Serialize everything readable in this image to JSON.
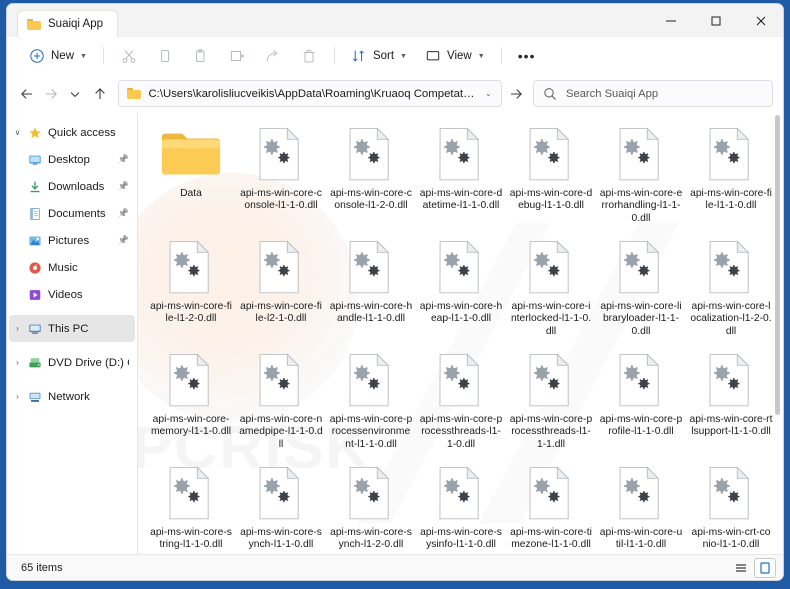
{
  "window": {
    "tab_title": "Suaiqi App",
    "minimize_label": "Minimize",
    "maximize_label": "Maximize",
    "close_label": "Close"
  },
  "toolbar": {
    "new_label": "New",
    "cut_label": "Cut",
    "copy_label": "Copy",
    "paste_label": "Paste",
    "rename_label": "Rename",
    "share_label": "Share",
    "delete_label": "Delete",
    "sort_label": "Sort",
    "view_label": "View",
    "more_label": "•••"
  },
  "navigation": {
    "back_label": "Back",
    "forward_label": "Forward",
    "recent_label": "Recent locations",
    "up_label": "Up",
    "address_path": "C:\\Users\\karolisliucveikis\\AppData\\Roaming\\Kruaoq Competation Corp\\Suaiqi App",
    "address_caret": "⌄",
    "go_label": "Go",
    "search_placeholder": "Search Suaiqi App"
  },
  "sidebar": {
    "items": [
      {
        "label": "Quick access",
        "icon": "star-icon",
        "chevron": "down",
        "indent": false,
        "pinned": false,
        "selected": false
      },
      {
        "label": "Desktop",
        "icon": "desktop-icon",
        "chevron": "none",
        "indent": true,
        "pinned": true,
        "selected": false
      },
      {
        "label": "Downloads",
        "icon": "downloads-icon",
        "chevron": "none",
        "indent": true,
        "pinned": true,
        "selected": false
      },
      {
        "label": "Documents",
        "icon": "documents-icon",
        "chevron": "none",
        "indent": true,
        "pinned": true,
        "selected": false
      },
      {
        "label": "Pictures",
        "icon": "pictures-icon",
        "chevron": "none",
        "indent": true,
        "pinned": true,
        "selected": false
      },
      {
        "label": "Music",
        "icon": "music-icon",
        "chevron": "none",
        "indent": true,
        "pinned": false,
        "selected": false
      },
      {
        "label": "Videos",
        "icon": "videos-icon",
        "chevron": "none",
        "indent": true,
        "pinned": false,
        "selected": false
      },
      {
        "label": "This PC",
        "icon": "this-pc-icon",
        "chevron": "right",
        "indent": false,
        "pinned": false,
        "selected": true
      },
      {
        "label": "DVD Drive (D:) CCCC",
        "icon": "dvd-drive-icon",
        "chevron": "right",
        "indent": false,
        "pinned": false,
        "selected": false
      },
      {
        "label": "Network",
        "icon": "network-icon",
        "chevron": "right",
        "indent": false,
        "pinned": false,
        "selected": false
      }
    ]
  },
  "files": [
    {
      "name": "Data",
      "type": "folder"
    },
    {
      "name": "api-ms-win-core-console-l1-1-0.dll",
      "type": "dll"
    },
    {
      "name": "api-ms-win-core-console-l1-2-0.dll",
      "type": "dll"
    },
    {
      "name": "api-ms-win-core-datetime-l1-1-0.dll",
      "type": "dll"
    },
    {
      "name": "api-ms-win-core-debug-l1-1-0.dll",
      "type": "dll"
    },
    {
      "name": "api-ms-win-core-errorhandling-l1-1-0.dll",
      "type": "dll"
    },
    {
      "name": "api-ms-win-core-file-l1-1-0.dll",
      "type": "dll"
    },
    {
      "name": "api-ms-win-core-file-l1-2-0.dll",
      "type": "dll"
    },
    {
      "name": "api-ms-win-core-file-l2-1-0.dll",
      "type": "dll"
    },
    {
      "name": "api-ms-win-core-handle-l1-1-0.dll",
      "type": "dll"
    },
    {
      "name": "api-ms-win-core-heap-l1-1-0.dll",
      "type": "dll"
    },
    {
      "name": "api-ms-win-core-interlocked-l1-1-0.dll",
      "type": "dll"
    },
    {
      "name": "api-ms-win-core-libraryloader-l1-1-0.dll",
      "type": "dll"
    },
    {
      "name": "api-ms-win-core-localization-l1-2-0.dll",
      "type": "dll"
    },
    {
      "name": "api-ms-win-core-memory-l1-1-0.dll",
      "type": "dll"
    },
    {
      "name": "api-ms-win-core-namedpipe-l1-1-0.dll",
      "type": "dll"
    },
    {
      "name": "api-ms-win-core-processenvironment-l1-1-0.dll",
      "type": "dll"
    },
    {
      "name": "api-ms-win-core-processthreads-l1-1-0.dll",
      "type": "dll"
    },
    {
      "name": "api-ms-win-core-processthreads-l1-1-1.dll",
      "type": "dll"
    },
    {
      "name": "api-ms-win-core-profile-l1-1-0.dll",
      "type": "dll"
    },
    {
      "name": "api-ms-win-core-rtlsupport-l1-1-0.dll",
      "type": "dll"
    },
    {
      "name": "api-ms-win-core-string-l1-1-0.dll",
      "type": "dll"
    },
    {
      "name": "api-ms-win-core-synch-l1-1-0.dll",
      "type": "dll"
    },
    {
      "name": "api-ms-win-core-synch-l1-2-0.dll",
      "type": "dll"
    },
    {
      "name": "api-ms-win-core-sysinfo-l1-1-0.dll",
      "type": "dll"
    },
    {
      "name": "api-ms-win-core-timezone-l1-1-0.dll",
      "type": "dll"
    },
    {
      "name": "api-ms-win-core-util-l1-1-0.dll",
      "type": "dll"
    },
    {
      "name": "api-ms-win-crt-conio-l1-1-0.dll",
      "type": "dll"
    }
  ],
  "status": {
    "item_count": "65 items",
    "list_view_label": "List view",
    "details_view_label": "Details view"
  },
  "watermark": {
    "text": "PCRISK"
  },
  "colors": {
    "window_bg": "#ffffff",
    "frame_blue": "#1f5aa6",
    "titlebar": "#f3f3f3",
    "folder_yellow": "#fbc850",
    "accent": "#0f6cbd",
    "selected_row": "#e6e6e6"
  }
}
